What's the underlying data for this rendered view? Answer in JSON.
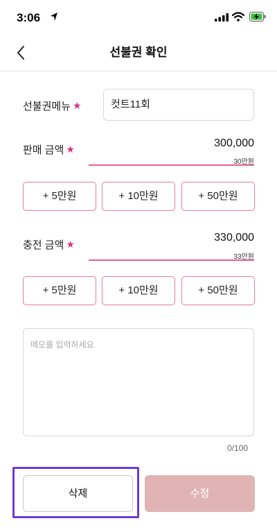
{
  "status_bar": {
    "time": "3:06",
    "icons": [
      "location-arrow-icon",
      "cellular-signal-icon",
      "wifi-icon",
      "battery-charging-icon"
    ]
  },
  "header": {
    "title": "선불권 확인",
    "back_icon": "chevron-left-icon"
  },
  "form": {
    "menu": {
      "label": "선불권메뉴",
      "required_mark": "★",
      "value": "컷트11회"
    },
    "sale_amount": {
      "label": "판매 금액",
      "required_mark": "★",
      "value": "300,000",
      "sub": "30만원",
      "quick_buttons": [
        "+ 5만원",
        "+ 10만원",
        "+ 50만원"
      ]
    },
    "charge_amount": {
      "label": "충전 금액",
      "required_mark": "★",
      "value": "330,000",
      "sub": "33만원",
      "quick_buttons": [
        "+ 5만원",
        "+ 10만원",
        "+ 50만원"
      ]
    },
    "memo": {
      "placeholder": "메모를 입력하세요",
      "counter": "0/100"
    }
  },
  "actions": {
    "delete_label": "삭제",
    "edit_label": "수정"
  },
  "colors": {
    "accent_pink": "#e9608c",
    "star": "#d63384",
    "edit_button_bg": "#e0b4b4",
    "highlight_border": "#6a3bd6"
  }
}
